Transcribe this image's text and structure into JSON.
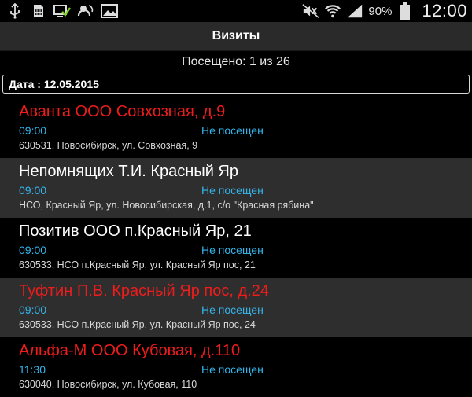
{
  "status_bar": {
    "battery_percent": "90%",
    "time": "12:00",
    "left_icons": [
      "usb-icon",
      "sim-icon",
      "check-monitor-icon",
      "cloud-sync-icon",
      "image-icon"
    ],
    "right_icons": [
      "mute-icon",
      "wifi-icon",
      "signal-icon",
      "battery-icon"
    ]
  },
  "header": {
    "title": "Визиты"
  },
  "summary": {
    "visited_text": "Посещено: 1 из 26"
  },
  "filter": {
    "date_label": "Дата : 12.05.2015"
  },
  "colors": {
    "red": "#ef1c1c",
    "blue": "#35b4ea",
    "item_bg_alt": "#2e2e2e"
  },
  "visits": [
    {
      "name": "Аванта ООО Совхозная, д.9",
      "time": "09:00",
      "status": "Не посещен",
      "address": "630531, Новосибирск, ул. Совхозная, 9",
      "highlight": "red"
    },
    {
      "name": "Непомнящих Т.И. Красный Яр",
      "time": "09:00",
      "status": "Не посещен",
      "address": "НСО, Красный Яр, ул. Новосибирская, д.1,  с/о \"Красная рябина\"",
      "highlight": "white"
    },
    {
      "name": "Позитив ООО п.Красный Яр, 21",
      "time": "09:00",
      "status": "Не посещен",
      "address": "630533, НСО п.Красный Яр, ул. Красный Яр пос, 21",
      "highlight": "white"
    },
    {
      "name": "Туфтин П.В. Красный Яр пос, д.24",
      "time": "09:00",
      "status": "Не посещен",
      "address": "630533, НСО п.Красный Яр, ул. Красный Яр пос, 24",
      "highlight": "red"
    },
    {
      "name": "Альфа-М ООО Кубовая, д.110",
      "time": "11:30",
      "status": "Не посещен",
      "address": "630040, Новосибирск, ул. Кубовая, 110",
      "highlight": "red"
    }
  ]
}
